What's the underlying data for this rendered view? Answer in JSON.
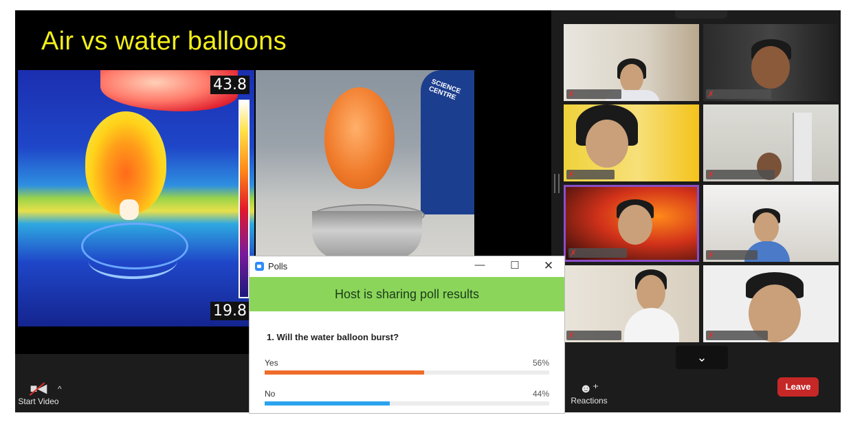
{
  "slide": {
    "title": "Air vs water balloons",
    "scale_top": "43.8",
    "scale_bottom": "19.8"
  },
  "toolbar": {
    "start_video_label": "Start Video",
    "caret": "^",
    "reactions_label": "Reactions",
    "leave_label": "Leave"
  },
  "gallery": {
    "down_icon": "⌄"
  },
  "poll": {
    "window_title": "Polls",
    "minimize": "—",
    "maximize": "☐",
    "close": "✕",
    "banner": "Host is sharing poll results",
    "question": "1. Will the water balloon burst?",
    "options": [
      {
        "label": "Yes",
        "percent": "56%",
        "value": 0.56,
        "color": "#ef6c2a"
      },
      {
        "label": "No",
        "percent": "44%",
        "value": 0.44,
        "color": "#2aa3ef"
      }
    ]
  },
  "colors": {
    "leave_button": "#c62828",
    "banner": "#8bd65a",
    "slide_title": "#f2ef1a"
  }
}
